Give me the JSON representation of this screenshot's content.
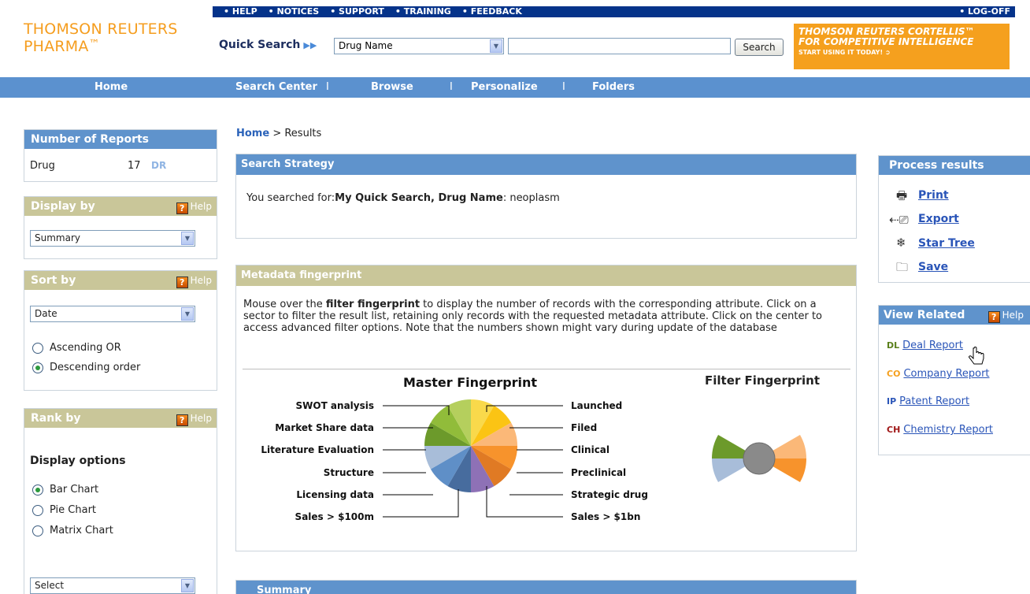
{
  "topbar": {
    "links": [
      "• HELP",
      "• NOTICES",
      "• SUPPORT",
      "• TRAINING",
      "• FEEDBACK"
    ],
    "logoff": "• LOG-OFF"
  },
  "logo": {
    "line1": "THOMSON REUTERS",
    "line2": "PHARMA",
    "tm": "™"
  },
  "quick_search": {
    "label": "Quick Search",
    "arrows": "▶▶",
    "field_selected": "Drug Name",
    "query": "",
    "button": "Search"
  },
  "promo": {
    "line1": "THOMSON REUTERS CORTELLIS™",
    "line2": "FOR COMPETITIVE INTELLIGENCE",
    "line3": "START USING IT TODAY!"
  },
  "nav": {
    "items": [
      "Home",
      "Search Center",
      "Browse",
      "Personalize",
      "Folders"
    ],
    "separator": "I"
  },
  "left": {
    "reports": {
      "title": "Number of Reports",
      "label": "Drug",
      "count": "17",
      "code": "DR"
    },
    "display_by": {
      "title": "Display by",
      "help": "Help",
      "selected": "Summary"
    },
    "sort_by": {
      "title": "Sort by",
      "help": "Help",
      "selected": "Date",
      "options": [
        {
          "label": "Ascending OR",
          "checked": false
        },
        {
          "label": "Descending order",
          "checked": true
        }
      ]
    },
    "rank_by": {
      "title": "Rank by",
      "help": "Help",
      "display_options_title": "Display options",
      "options": [
        {
          "label": "Bar Chart",
          "checked": true
        },
        {
          "label": "Pie Chart",
          "checked": false
        },
        {
          "label": "Matrix Chart",
          "checked": false
        }
      ],
      "select_placeholder": "Select"
    }
  },
  "breadcrumb": {
    "home": "Home",
    "sep": " > ",
    "current": "Results"
  },
  "strategy": {
    "title": "Search Strategy",
    "prefix": "You searched for:",
    "query_bold": "My Quick Search, Drug Name",
    "query_value": ": neoplasm"
  },
  "fingerprint": {
    "title": "Metadata fingerprint",
    "desc_pre": "Mouse over the ",
    "desc_bold": "filter fingerprint",
    "desc_post": " to display the number of records with the corresponding attribute. Click on a sector to filter the result list, retaining only records with the requested metadata attribute. Click on the center to access advanced filter options. Note that the numbers shown might vary during update of the database",
    "master_title": "Master Fingerprint",
    "filter_title": "Filter Fingerprint",
    "left_labels": [
      "SWOT analysis",
      "Market Share data",
      "Literature Evaluation",
      "Structure",
      "Licensing data",
      "Sales > $100m"
    ],
    "right_labels": [
      "Launched",
      "Filed",
      "Clinical",
      "Preclinical",
      "Strategic drug",
      "Sales > $1bn"
    ],
    "sector_colors": [
      "#f9d94b",
      "#fbc414",
      "#fbb878",
      "#f7932c",
      "#e07a24",
      "#8e71b6",
      "#476c9e",
      "#5f8fc7",
      "#a8bdd9",
      "#6c9a2b",
      "#91bc3a",
      "#b5cf5d"
    ],
    "filter_colors": {
      "left_top": "#6c9a2b",
      "left_bottom": "#a8bdd9",
      "right_top": "#fbb878",
      "right_bottom": "#f7932c",
      "center": "#8a8a8a"
    }
  },
  "summary": {
    "title": "Summary"
  },
  "process": {
    "title": "Process results",
    "items": [
      {
        "icon": "print-icon",
        "label": "Print"
      },
      {
        "icon": "export-icon",
        "label": "Export"
      },
      {
        "icon": "star-tree-icon",
        "label": "Star Tree"
      },
      {
        "icon": "folder-icon",
        "label": "Save"
      }
    ]
  },
  "view_related": {
    "title": "View Related",
    "help": "Help",
    "items": [
      {
        "code": "DL",
        "label": "Deal Report",
        "color": "#5a7f1a"
      },
      {
        "code": "CO",
        "label": "Company Report",
        "color": "#f5a01e"
      },
      {
        "code": "IP",
        "label": "Patent Report",
        "color": "#2a55b8"
      },
      {
        "code": "CH",
        "label": "Chemistry Report",
        "color": "#a01818"
      }
    ]
  }
}
